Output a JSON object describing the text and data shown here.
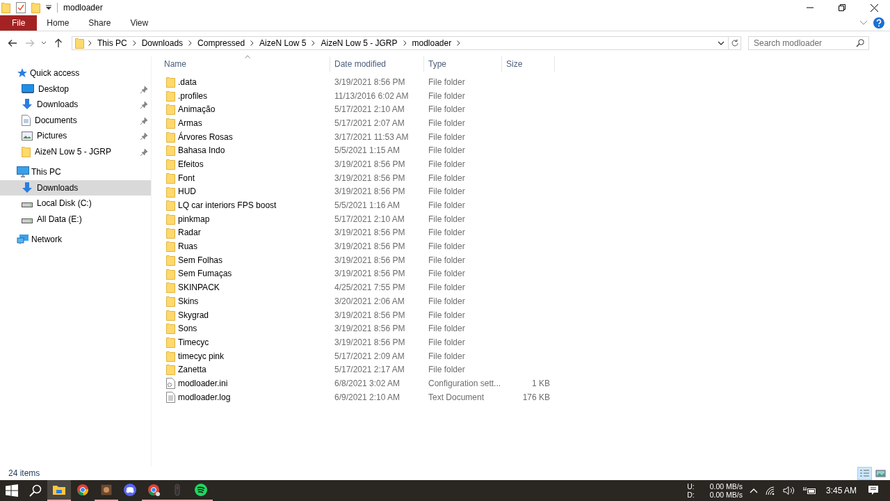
{
  "window": {
    "title": "modloader"
  },
  "ribbon_tabs": [
    {
      "label": "File",
      "kind": "file",
      "selected": false
    },
    {
      "label": "Home",
      "kind": "tab",
      "selected": false
    },
    {
      "label": "Share",
      "kind": "tab",
      "selected": false
    },
    {
      "label": "View",
      "kind": "tab",
      "selected": false
    }
  ],
  "address_bar": {
    "crumbs": [
      "This PC",
      "Downloads",
      "Compressed",
      "AizeN Low 5",
      "AizeN Low 5 - JGRP",
      "modloader"
    ]
  },
  "search": {
    "placeholder": "Search modloader"
  },
  "sidebar": {
    "items": [
      {
        "label": "Quick access",
        "kind": "star",
        "selected": false,
        "children": [
          {
            "label": "Desktop",
            "kind": "desktop",
            "pinned": true,
            "selected": false
          },
          {
            "label": "Downloads",
            "kind": "download",
            "pinned": true,
            "selected": false
          },
          {
            "label": "Documents",
            "kind": "document",
            "pinned": true,
            "selected": false
          },
          {
            "label": "Pictures",
            "kind": "pictures",
            "pinned": true,
            "selected": false
          },
          {
            "label": "AizeN Low 5 - JGRP",
            "kind": "folder",
            "pinned": true,
            "selected": false
          }
        ]
      },
      {
        "label": "This PC",
        "kind": "pc",
        "selected": false,
        "children": [
          {
            "label": "Downloads",
            "kind": "download",
            "pinned": false,
            "selected": true
          },
          {
            "label": "Local Disk (C:)",
            "kind": "disk",
            "pinned": false,
            "selected": false
          },
          {
            "label": "All Data (E:)",
            "kind": "disk",
            "pinned": false,
            "selected": false
          }
        ]
      },
      {
        "label": "Network",
        "kind": "network",
        "selected": false
      }
    ]
  },
  "table": {
    "columns": [
      {
        "label": "Name",
        "sorted": true
      },
      {
        "label": "Date modified",
        "sorted": false
      },
      {
        "label": "Type",
        "sorted": false
      },
      {
        "label": "Size",
        "sorted": false
      }
    ],
    "rows": [
      {
        "name": ".data",
        "date": "3/19/2021 8:56 PM",
        "type": "File folder",
        "kind": "folder"
      },
      {
        "name": ".profiles",
        "date": "11/13/2016 6:02 AM",
        "type": "File folder",
        "kind": "folder"
      },
      {
        "name": "Animação",
        "date": "5/17/2021 2:10 AM",
        "type": "File folder",
        "kind": "folder"
      },
      {
        "name": "Armas",
        "date": "5/17/2021 2:07 AM",
        "type": "File folder",
        "kind": "folder"
      },
      {
        "name": "Árvores Rosas",
        "date": "3/17/2021 11:53 AM",
        "type": "File folder",
        "kind": "folder"
      },
      {
        "name": "Bahasa Indo",
        "date": "5/5/2021 1:15 AM",
        "type": "File folder",
        "kind": "folder"
      },
      {
        "name": "Efeitos",
        "date": "3/19/2021 8:56 PM",
        "type": "File folder",
        "kind": "folder"
      },
      {
        "name": "Font",
        "date": "3/19/2021 8:56 PM",
        "type": "File folder",
        "kind": "folder"
      },
      {
        "name": "HUD",
        "date": "3/19/2021 8:56 PM",
        "type": "File folder",
        "kind": "folder"
      },
      {
        "name": "LQ car interiors FPS boost",
        "date": "5/5/2021 1:16 AM",
        "type": "File folder",
        "kind": "folder"
      },
      {
        "name": "pinkmap",
        "date": "5/17/2021 2:10 AM",
        "type": "File folder",
        "kind": "folder"
      },
      {
        "name": "Radar",
        "date": "3/19/2021 8:56 PM",
        "type": "File folder",
        "kind": "folder"
      },
      {
        "name": "Ruas",
        "date": "3/19/2021 8:56 PM",
        "type": "File folder",
        "kind": "folder"
      },
      {
        "name": "Sem Folhas",
        "date": "3/19/2021 8:56 PM",
        "type": "File folder",
        "kind": "folder"
      },
      {
        "name": "Sem Fumaças",
        "date": "3/19/2021 8:56 PM",
        "type": "File folder",
        "kind": "folder"
      },
      {
        "name": "SKINPACK",
        "date": "4/25/2021 7:55 PM",
        "type": "File folder",
        "kind": "folder"
      },
      {
        "name": "Skins",
        "date": "3/20/2021 2:06 AM",
        "type": "File folder",
        "kind": "folder"
      },
      {
        "name": "Skygrad",
        "date": "3/19/2021 8:56 PM",
        "type": "File folder",
        "kind": "folder"
      },
      {
        "name": "Sons",
        "date": "3/19/2021 8:56 PM",
        "type": "File folder",
        "kind": "folder"
      },
      {
        "name": "Timecyc",
        "date": "3/19/2021 8:56 PM",
        "type": "File folder",
        "kind": "folder"
      },
      {
        "name": "timecyc pink",
        "date": "5/17/2021 2:09 AM",
        "type": "File folder",
        "kind": "folder"
      },
      {
        "name": "Zanetta",
        "date": "5/17/2021 2:17 AM",
        "type": "File folder",
        "kind": "folder"
      },
      {
        "name": "modloader.ini",
        "date": "6/8/2021 3:02 AM",
        "type": "Configuration sett...",
        "size": "1 KB",
        "kind": "settings"
      },
      {
        "name": "modloader.log",
        "date": "6/9/2021 2:10 AM",
        "type": "Text Document",
        "size": "176 KB",
        "kind": "text"
      }
    ]
  },
  "status_bar": {
    "item_count": "24 items",
    "views": [
      {
        "kind": "details",
        "selected": true
      },
      {
        "kind": "tiles",
        "selected": false
      }
    ]
  },
  "taskbar": {
    "apps": [
      {
        "kind": "explorer",
        "active": true,
        "running": true
      },
      {
        "kind": "chrome",
        "active": false,
        "running": false
      },
      {
        "kind": "game",
        "active": false,
        "running": true
      },
      {
        "kind": "discord",
        "active": false,
        "running": false
      },
      {
        "kind": "chrome-profile",
        "active": false,
        "running": true
      },
      {
        "kind": "mouse",
        "active": false,
        "running": true
      },
      {
        "kind": "spotify",
        "active": false,
        "running": true
      }
    ],
    "net_speed": [
      {
        "label": "U:",
        "value": "0.00 MB/s"
      },
      {
        "label": "D:",
        "value": "0.00 MB/s"
      }
    ],
    "time": "3:45 AM"
  }
}
